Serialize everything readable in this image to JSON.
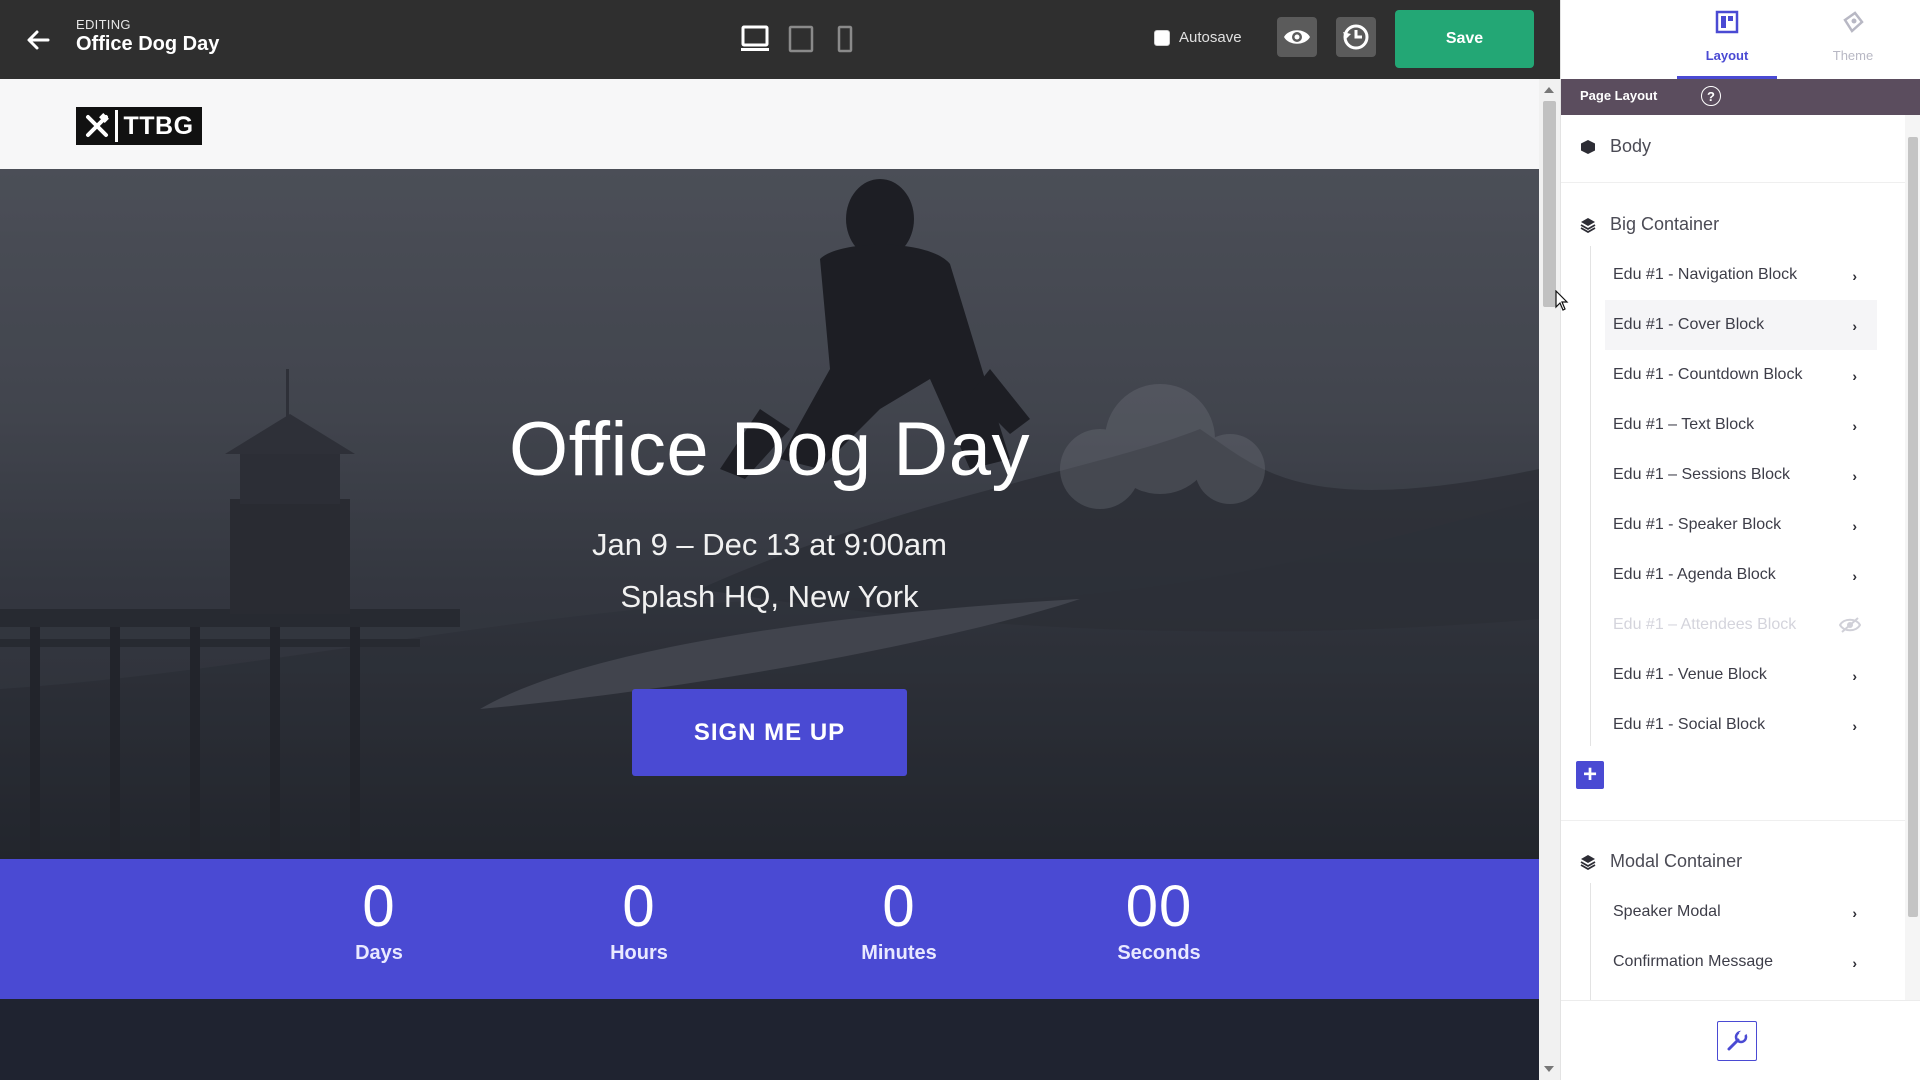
{
  "editor": {
    "editing_label": "EDITING",
    "title": "Office Dog Day",
    "autosave_label": "Autosave",
    "save_label": "Save",
    "accent": "#4a4ad3",
    "save_color": "#23a775"
  },
  "page": {
    "logo_text": "TTBG",
    "hero_title": "Office Dog Day",
    "hero_date": "Jan 9 – Dec 13 at 9:00am",
    "hero_location": "Splash HQ, New York",
    "cta_label": "SIGN ME UP",
    "countdown": [
      {
        "value": "0",
        "label": "Days"
      },
      {
        "value": "0",
        "label": "Hours"
      },
      {
        "value": "0",
        "label": "Minutes"
      },
      {
        "value": "00",
        "label": "Seconds"
      }
    ]
  },
  "panel": {
    "tabs": [
      {
        "label": "Layout",
        "icon": "layout-icon",
        "active": true
      },
      {
        "label": "Theme",
        "icon": "theme-icon",
        "active": false
      }
    ],
    "section_title": "Page Layout",
    "help_label": "?",
    "body_label": "Body",
    "big_container": {
      "label": "Big Container",
      "items": [
        {
          "label": "Edu #1 - Navigation Block"
        },
        {
          "label": "Edu #1 - Cover Block"
        },
        {
          "label": "Edu #1 - Countdown Block"
        },
        {
          "label": "Edu #1 – Text Block"
        },
        {
          "label": "Edu #1 – Sessions Block"
        },
        {
          "label": "Edu #1 - Speaker Block"
        },
        {
          "label": "Edu #1 - Agenda Block"
        },
        {
          "label": "Edu #1 – Attendees Block"
        },
        {
          "label": "Edu #1 - Venue Block"
        },
        {
          "label": "Edu #1 - Social Block"
        }
      ]
    },
    "modal_container": {
      "label": "Modal Container",
      "items": [
        {
          "label": "Speaker Modal"
        },
        {
          "label": "Confirmation Message"
        }
      ]
    }
  }
}
